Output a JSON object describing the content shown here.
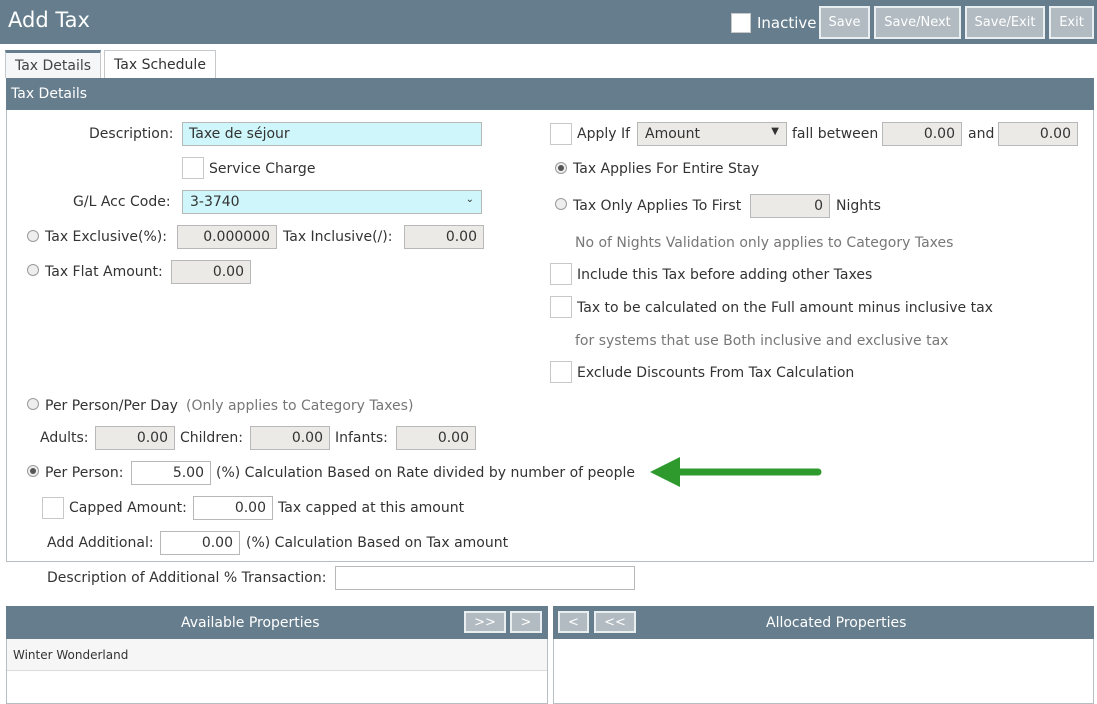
{
  "window": {
    "title": "Add Tax"
  },
  "toolbar": {
    "inactive_label": "Inactive",
    "save_label": "Save",
    "save_next_label": "Save/Next",
    "save_exit_label": "Save/Exit",
    "exit_label": "Exit"
  },
  "tabs": [
    {
      "label": "Tax Details"
    },
    {
      "label": "Tax Schedule"
    }
  ],
  "panel": {
    "header": "Tax Details"
  },
  "form": {
    "description_label": "Description:",
    "description_value": "Taxe de séjour",
    "service_charge_label": "Service Charge",
    "gl_label": "G/L Acc Code:",
    "gl_value": "3-3740",
    "tax_exclusive_label": "Tax Exclusive(%):",
    "tax_exclusive_value": "0.000000",
    "tax_inclusive_label": "Tax Inclusive(/):",
    "tax_inclusive_value": "0.00",
    "tax_flat_label": "Tax Flat Amount:",
    "tax_flat_value": "0.00",
    "apply_if_label": "Apply If",
    "apply_if_option": "Amount",
    "fall_between_label": "fall between",
    "fall_from": "0.00",
    "and_label": "and",
    "fall_to": "0.00",
    "entire_stay_label": "Tax Applies For Entire Stay",
    "first_nights_label": "Tax Only Applies To First",
    "first_nights_value": "0",
    "nights_label": "Nights",
    "nights_note": "No of Nights Validation only applies to Category Taxes",
    "include_before_label": "Include this Tax before adding other Taxes",
    "full_amount_label": "Tax to be calculated on the Full amount minus inclusive tax",
    "full_amount_note": "for systems that use Both inclusive and exclusive tax",
    "exclude_discounts_label": "Exclude Discounts From Tax Calculation",
    "ppd_label": "Per Person/Per Day",
    "ppd_note": "(Only applies to Category Taxes)",
    "adults_label": "Adults:",
    "adults_value": "0.00",
    "children_label": "Children:",
    "children_value": "0.00",
    "infants_label": "Infants:",
    "infants_value": "0.00",
    "per_person_label": "Per Person:",
    "per_person_value": "5.00",
    "per_person_note": "(%) Calculation Based on Rate divided by number of people",
    "capped_label": "Capped Amount:",
    "capped_value": "0.00",
    "capped_note": "Tax capped at this amount",
    "add_additional_label": "Add Additional:",
    "add_additional_value": "0.00",
    "add_additional_note": "(%) Calculation Based on Tax amount",
    "desc_additional_label": "Description of Additional % Transaction:",
    "desc_additional_value": ""
  },
  "properties": {
    "available_title": "Available Properties",
    "allocated_title": "Allocated Properties",
    "add_all_label": ">>",
    "add_label": ">",
    "remove_label": "<",
    "remove_all_label": "<<",
    "available": [
      "Winter Wonderland"
    ]
  },
  "colors": {
    "header": "#657d8c",
    "button": "#b1bbc1",
    "highlight_input": "#cff6fa",
    "arrow": "#2e9a2e"
  },
  "annotation": {
    "icon": "green-arrow-icon"
  }
}
